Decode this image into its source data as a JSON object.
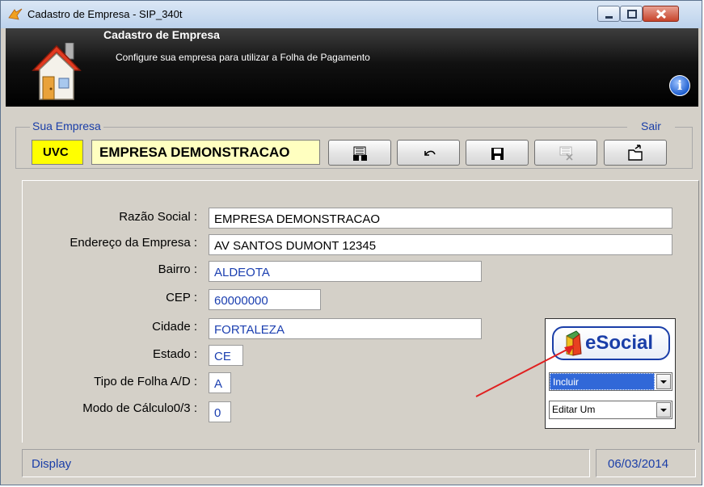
{
  "window": {
    "title": "Cadastro de Empresa  - SIP_340t"
  },
  "header": {
    "title": "Cadastro de Empresa",
    "subtitle": "Configure sua empresa para utilizar a Folha de Pagamento"
  },
  "company": {
    "group_label": "Sua Empresa",
    "code": "UVC",
    "name": "EMPRESA DEMONSTRACAO",
    "exit_label": "Sair"
  },
  "toolbar": {
    "buttons": [
      "search-icon",
      "undo-icon",
      "save-icon",
      "delete-icon",
      "exit-folder-icon"
    ]
  },
  "form": {
    "fields": [
      {
        "label": "Razão Social :",
        "value": "EMPRESA DEMONSTRACAO"
      },
      {
        "label": "Endereço da Empresa :",
        "value": "AV SANTOS DUMONT 12345"
      },
      {
        "label": "Bairro :",
        "value": "ALDEOTA"
      },
      {
        "label": "CEP :",
        "value": "60000000"
      },
      {
        "label": "Cidade :",
        "value": "FORTALEZA"
      },
      {
        "label": "Estado :",
        "value": "CE"
      },
      {
        "label": "Tipo de Folha A/D :",
        "value": "A"
      },
      {
        "label": "Modo de Cálculo0/3 :",
        "value": "0"
      }
    ]
  },
  "esocial": {
    "logo_text": "eSocial",
    "action_selected": "Incluir",
    "mode_selected": "Editar Um"
  },
  "status": {
    "mode": "Display",
    "date": "06/03/2014"
  },
  "colors": {
    "label_blue": "#1a3ea8",
    "code_bg": "#ffff00",
    "name_bg": "#ffffc0",
    "arrow_red": "#e02020"
  }
}
